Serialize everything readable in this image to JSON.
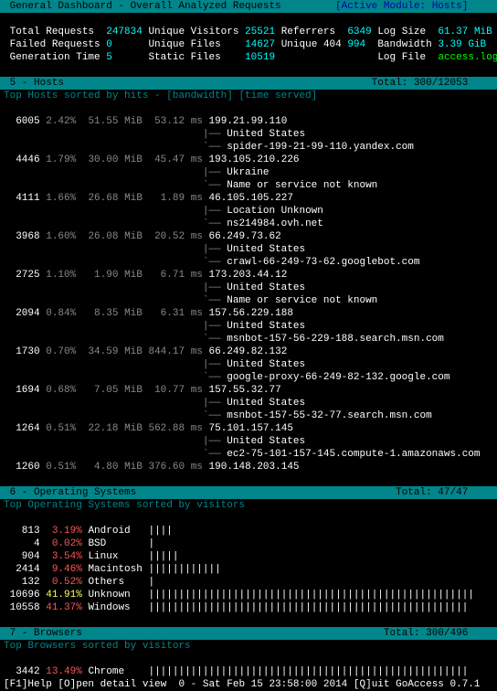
{
  "title_left": "General Dashboard - Overall Analyzed Requests",
  "title_right": "[Active Module: Hosts]",
  "summary": {
    "row1": {
      "l1": "Total Requests",
      "v1": "247834",
      "l2": "Unique Visitors",
      "v2": "25521",
      "l3": "Referrers",
      "v3": "6349",
      "l4": "Log Size",
      "v4": "61.37 MiB"
    },
    "row2": {
      "l1": "Failed Requests",
      "v1": "0",
      "l2": "Unique Files",
      "v2": "14627",
      "l3": "Unique 404",
      "v3": "994",
      "l4": "Bandwidth",
      "v4": "3.39 GiB"
    },
    "row3": {
      "l1": "Generation Time",
      "v1": "5",
      "l2": "Static Files",
      "v2": "10519",
      "l3": "",
      "v3": "",
      "l4": "Log File",
      "v4": "access.log"
    }
  },
  "hosts": {
    "panel_num": "5",
    "panel_title": "Hosts",
    "total": "Total: 300/12053",
    "subtitle": "Top Hosts sorted by hits - [bandwidth] [time served]",
    "rows": [
      {
        "hits": "6005",
        "pct": "2.42%",
        "bw": "51.55 MiB",
        "ts": "53.12 ms",
        "ip": "199.21.99.110",
        "c1": "United States",
        "c2": "spider-199-21-99-110.yandex.com"
      },
      {
        "hits": "4446",
        "pct": "1.79%",
        "bw": "30.00 MiB",
        "ts": "45.47 ms",
        "ip": "193.105.210.226",
        "c1": "Ukraine",
        "c2": "Name or service not known"
      },
      {
        "hits": "4111",
        "pct": "1.66%",
        "bw": "26.68 MiB",
        "ts": "1.89 ms",
        "ip": "46.105.105.227",
        "c1": "Location Unknown",
        "c2": "ns214984.ovh.net"
      },
      {
        "hits": "3968",
        "pct": "1.60%",
        "bw": "26.08 MiB",
        "ts": "20.52 ms",
        "ip": "66.249.73.62",
        "c1": "United States",
        "c2": "crawl-66-249-73-62.googlebot.com"
      },
      {
        "hits": "2725",
        "pct": "1.10%",
        "bw": "1.90 MiB",
        "ts": "6.71 ms",
        "ip": "173.203.44.12",
        "c1": "United States",
        "c2": "Name or service not known"
      },
      {
        "hits": "2094",
        "pct": "0.84%",
        "bw": "8.35 MiB",
        "ts": "6.31 ms",
        "ip": "157.56.229.188",
        "c1": "United States",
        "c2": "msnbot-157-56-229-188.search.msn.com"
      },
      {
        "hits": "1730",
        "pct": "0.70%",
        "bw": "34.59 MiB",
        "ts": "844.17 ms",
        "ip": "66.249.82.132",
        "c1": "United States",
        "c2": "google-proxy-66-249-82-132.google.com"
      },
      {
        "hits": "1694",
        "pct": "0.68%",
        "bw": "7.05 MiB",
        "ts": "10.77 ms",
        "ip": "157.55.32.77",
        "c1": "United States",
        "c2": "msnbot-157-55-32-77.search.msn.com"
      },
      {
        "hits": "1264",
        "pct": "0.51%",
        "bw": "22.18 MiB",
        "ts": "562.88 ms",
        "ip": "75.101.157.145",
        "c1": "United States",
        "c2": "ec2-75-101-157-145.compute-1.amazonaws.com"
      },
      {
        "hits": "1260",
        "pct": "0.51%",
        "bw": "4.80 MiB",
        "ts": "376.60 ms",
        "ip": "190.148.203.145",
        "c1": null,
        "c2": null
      }
    ]
  },
  "os": {
    "panel_num": "6",
    "panel_title": "Operating Systems",
    "total": "Total: 47/47",
    "subtitle": "Top Operating Systems sorted by visitors",
    "rows": [
      {
        "hits": "813",
        "pct": "3.19%",
        "pctc": "red",
        "name": "Android",
        "bar": "||||"
      },
      {
        "hits": "4",
        "pct": "0.02%",
        "pctc": "red",
        "name": "BSD",
        "bar": "|"
      },
      {
        "hits": "904",
        "pct": "3.54%",
        "pctc": "red",
        "name": "Linux",
        "bar": "|||||"
      },
      {
        "hits": "2414",
        "pct": "9.46%",
        "pctc": "red",
        "name": "Macintosh",
        "bar": "||||||||||||"
      },
      {
        "hits": "132",
        "pct": "0.52%",
        "pctc": "red",
        "name": "Others",
        "bar": "|"
      },
      {
        "hits": "10696",
        "pct": "41.91%",
        "pctc": "yellow",
        "name": "Unknown",
        "bar": "||||||||||||||||||||||||||||||||||||||||||||||||||||||"
      },
      {
        "hits": "10558",
        "pct": "41.37%",
        "pctc": "red",
        "name": "Windows",
        "bar": "|||||||||||||||||||||||||||||||||||||||||||||||||||||"
      }
    ]
  },
  "browsers": {
    "panel_num": "7",
    "panel_title": "Browsers",
    "total": "Total: 300/496",
    "subtitle": "Top Browsers sorted by visitors",
    "rows": [
      {
        "hits": "3442",
        "pct": "13.49%",
        "name": "Chrome",
        "bar": "|||||||||||||||||||||||||||||||||||||||||||||||||||||"
      }
    ]
  },
  "footer": {
    "help": "[F1]Help [O]pen detail view",
    "date": "0 - Sat Feb 15 23:58:00 2014",
    "quit": "[Q]uit GoAccess 0.7.1"
  }
}
